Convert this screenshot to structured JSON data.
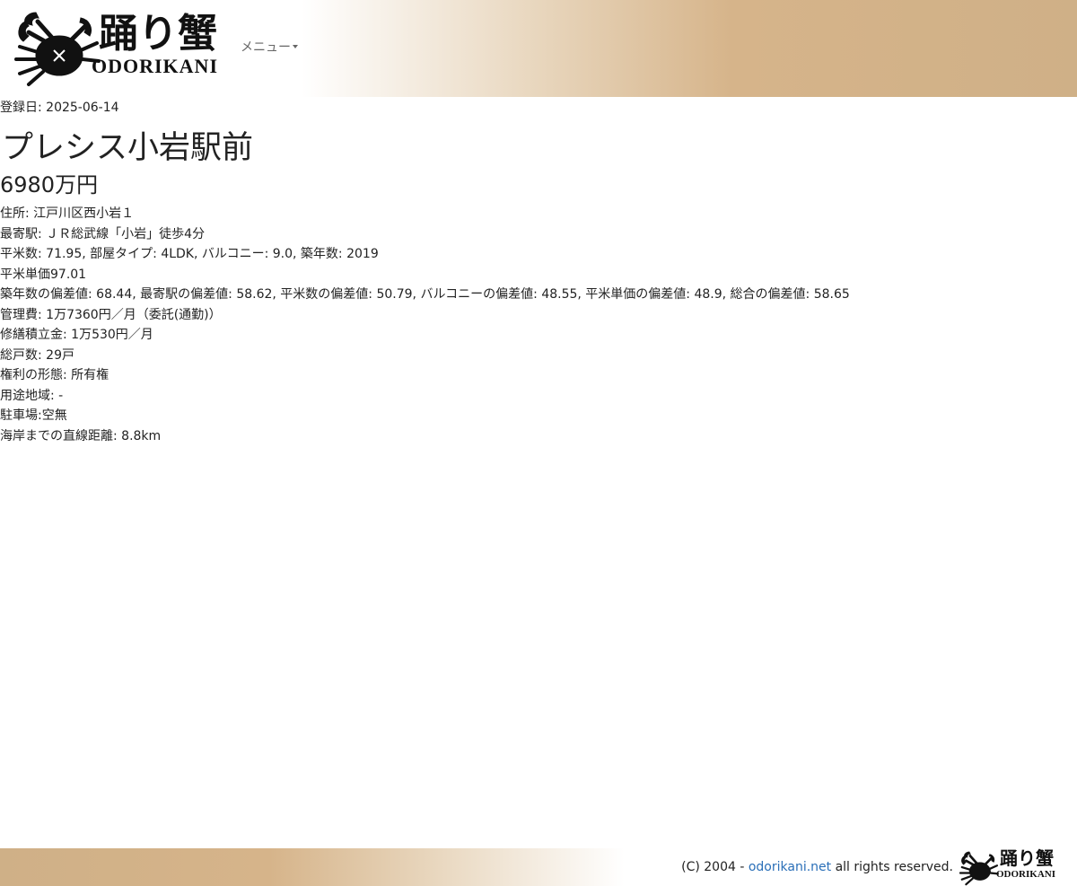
{
  "header": {
    "logo_kanji": "踊り蟹",
    "logo_roman": "ODORIKANI",
    "menu_label": "メニュー"
  },
  "property": {
    "registered": "登録日: 2025-06-14",
    "title": "プレシス小岩駅前",
    "price": "6980万円",
    "address": "住所: 江戸川区西小岩１",
    "station": "最寄駅: ＪＲ総武線「小岩」徒歩4分",
    "specs": "平米数: 71.95, 部屋タイプ: 4LDK, バルコニー: 9.0, 築年数: 2019",
    "unit_price": "平米単価97.01",
    "deviations": "築年数の偏差値: 68.44, 最寄駅の偏差値: 58.62, 平米数の偏差値: 50.79, バルコニーの偏差値: 48.55, 平米単価の偏差値: 48.9, 総合の偏差値: 58.65",
    "management_fee": "管理費: 1万7360円／月（委託(通勤)）",
    "repair_fund": "修繕積立金: 1万530円／月",
    "total_units": "総戸数: 29戸",
    "ownership": "権利の形態: 所有権",
    "zoning": "用途地域: -",
    "parking": "駐車場:空無",
    "coast_distance": "海岸までの直線距離: 8.8km"
  },
  "footer": {
    "copyright_prefix": "(C) 2004 - ",
    "site_link": "odorikani.net",
    "copyright_suffix": " all rights reserved.",
    "logo_kanji": "踊り蟹",
    "logo_roman": "ODORIKANI"
  },
  "colors": {
    "header_gradient_end": "#cfb087",
    "link": "#2a6fb8"
  },
  "icons": {
    "logo": "crab-icon",
    "menu_caret": "caret-down-icon"
  }
}
